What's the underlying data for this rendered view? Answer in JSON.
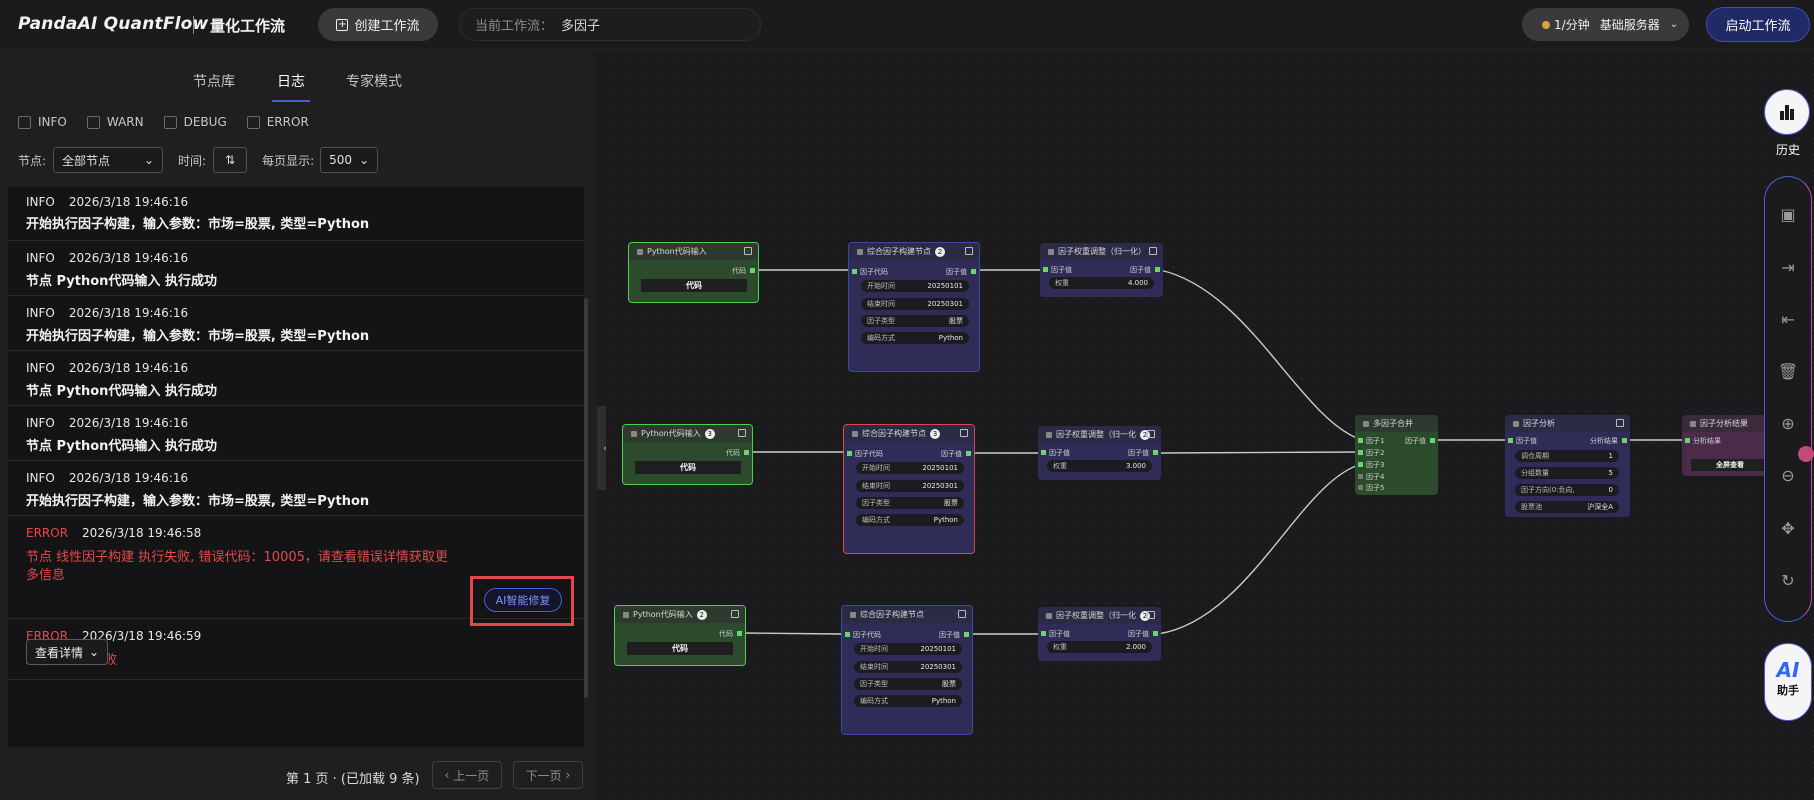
{
  "header": {
    "brand": "PandaAI QuantFlow",
    "subtitle": "量化工作流",
    "create_button": "创建工作流",
    "current_label": "当前工作流：",
    "current_value": "多因子",
    "server_price": "1/分钟",
    "server_name": "基础服务器",
    "start_button": "启动工作流"
  },
  "panel": {
    "tabs": [
      "节点库",
      "日志",
      "专家模式"
    ],
    "active_tab": "日志",
    "filters": [
      "INFO",
      "WARN",
      "DEBUG",
      "ERROR"
    ],
    "node_label": "节点:",
    "node_select": "全部节点",
    "time_label": "时间:",
    "per_page_label": "每页显示:",
    "per_page_value": "500",
    "logs": [
      {
        "level": "INFO",
        "time": "2026/3/18 19:46:16",
        "message": "开始执行因子构建，输入参数：市场=股票, 类型=Python"
      },
      {
        "level": "INFO",
        "time": "2026/3/18 19:46:16",
        "message": "节点 Python代码输入 执行成功"
      },
      {
        "level": "INFO",
        "time": "2026/3/18 19:46:16",
        "message": "开始执行因子构建，输入参数：市场=股票, 类型=Python"
      },
      {
        "level": "INFO",
        "time": "2026/3/18 19:46:16",
        "message": "节点 Python代码输入 执行成功"
      },
      {
        "level": "INFO",
        "time": "2026/3/18 19:46:16",
        "message": "节点 Python代码输入 执行成功"
      },
      {
        "level": "INFO",
        "time": "2026/3/18 19:46:16",
        "message": "开始执行因子构建，输入参数：市场=股票, 类型=Python"
      },
      {
        "level": "ERROR",
        "time": "2026/3/18 19:46:58",
        "message_line1": "节点 线性因子构建 执行失败, 错误代码：10005，请查看错误详情获取更",
        "message_line2": "多信息"
      },
      {
        "level": "ERROR",
        "time": "2026/3/18 19:46:59",
        "message": "工作流执行失败"
      }
    ],
    "ai_fix": "AI智能修复",
    "view_detail": "查看详情",
    "pager_info": "第 1 页 · (已加载 9 条)",
    "prev": "上一页",
    "next": "下一页"
  },
  "canvas": {
    "py_title": "Python代码输入",
    "out_code": "代码",
    "code_value": "代码",
    "comp_title": "综合因子构建节点",
    "comp_in": "因子代码",
    "comp_out": "因子值",
    "start_k": "开始时间",
    "start_v": "20250101",
    "end_k": "结束时间",
    "end_v": "20250301",
    "type_k": "因子类型",
    "type_v": "股票",
    "enc_k": "编码方式",
    "enc_v": "Python",
    "w_title": "因子权重调整（归一化）",
    "w_title_short": "因子权重调整（归一化",
    "w_in": "因子值",
    "w_out": "因子值",
    "w_k": "权重",
    "w_vals": [
      "4.000",
      "3.000",
      "2.000"
    ],
    "merge_title": "多因子合并",
    "merge_inputs": [
      "因子1",
      "因子2",
      "因子3",
      "因子4",
      "因子5"
    ],
    "merge_out": "因子值",
    "ana_title": "因子分析",
    "ana_in": "因子值",
    "ana_out": "分析结果",
    "ana_fields": [
      {
        "k": "调仓周期",
        "v": "1"
      },
      {
        "k": "分组数量",
        "v": "5"
      },
      {
        "k": "因子方向(0:负向,",
        "v": "0"
      },
      {
        "k": "股票池",
        "v": "沪深全A"
      }
    ],
    "res_title": "因子分析结果",
    "res_in": "分析结果",
    "res_btn": "全屏查看",
    "badges": [
      "2",
      "3",
      "2",
      "3",
      "2",
      "3"
    ]
  },
  "toolbar": {
    "history": "历史",
    "ai": "AI",
    "assistant": "助手"
  }
}
